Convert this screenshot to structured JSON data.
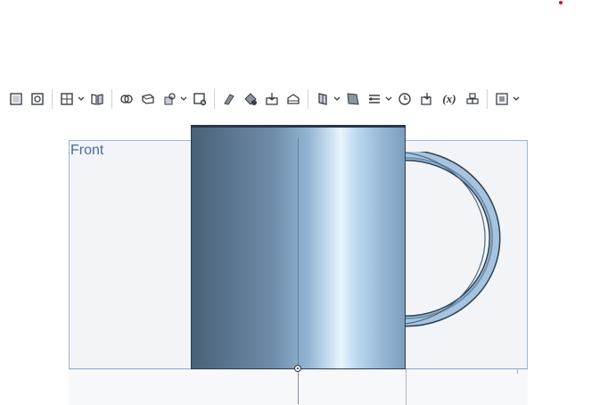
{
  "viewport": {
    "plane_label": "Front"
  },
  "toolbar": {
    "buttons": [
      {
        "icon": "sketch-icon"
      },
      {
        "icon": "extrude-icon"
      },
      {
        "icon": "layout-grid-icon"
      },
      {
        "icon": "mirror-book-icon"
      },
      {
        "icon": "boolean-icon"
      },
      {
        "icon": "shell-icon"
      },
      {
        "icon": "transform-icon"
      },
      {
        "icon": "delete-part-icon"
      },
      {
        "icon": "fillet-icon"
      },
      {
        "icon": "chamfer-icon"
      },
      {
        "icon": "move-face-icon"
      },
      {
        "icon": "replace-face-icon"
      },
      {
        "icon": "loft-icon"
      },
      {
        "icon": "plane-icon"
      },
      {
        "icon": "layers-icon"
      },
      {
        "icon": "clock-icon"
      },
      {
        "icon": "import-icon"
      },
      {
        "icon": "variable-icon"
      },
      {
        "icon": "assembly-icon"
      },
      {
        "icon": "export-icon"
      }
    ],
    "variable_label": "(x)"
  },
  "colors": {
    "accent": "#4a6d9a",
    "mug_dark": "#4a6177",
    "mug_highlight": "#e8f4ff",
    "plane_fill": "#f2f4f7",
    "status_dot": "#d41818"
  }
}
